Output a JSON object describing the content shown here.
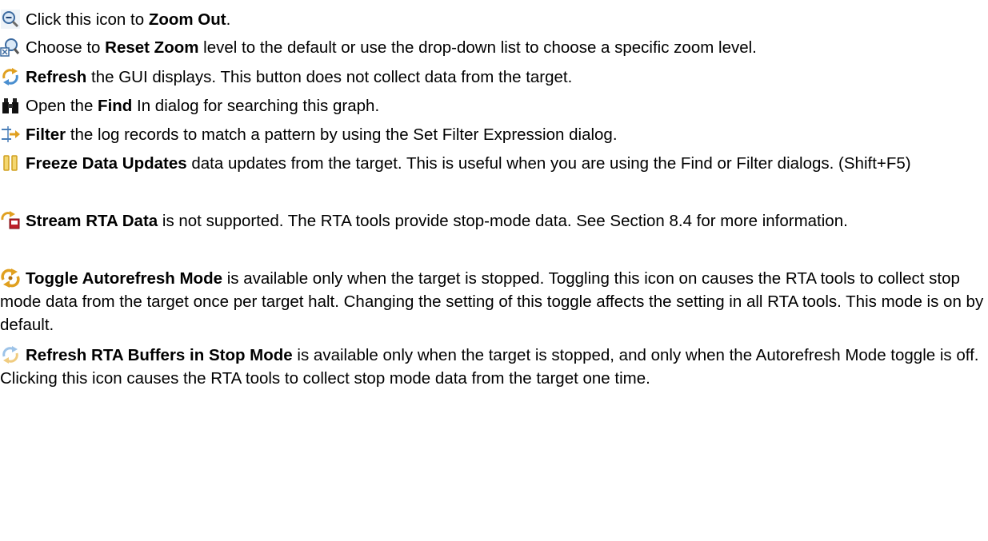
{
  "entries": [
    {
      "id": "zoom-out",
      "icon": "zoom-out-icon",
      "pre": "Click this icon to ",
      "bold": "Zoom Out",
      "post": "."
    },
    {
      "id": "reset-zoom",
      "icon": "reset-zoom-icon",
      "pre": "Choose to ",
      "bold": "Reset Zoom",
      "post": " level to the default or use the drop-down list to choose a specific zoom level."
    },
    {
      "id": "refresh",
      "icon": "refresh-icon",
      "pre": "",
      "bold": "Refresh",
      "post": " the GUI displays. This button does not collect data from the target."
    },
    {
      "id": "find",
      "icon": "binoculars-icon",
      "pre": "Open the ",
      "bold": "Find",
      "post": " In dialog for searching this graph."
    },
    {
      "id": "filter",
      "icon": "filter-icon",
      "pre": "",
      "bold": "Filter",
      "post": " the log records to match a pattern by using the Set Filter Expression dialog."
    },
    {
      "id": "freeze",
      "icon": "pause-icon",
      "pre": "",
      "bold": "Freeze Data Updates",
      "post": " data updates from the target. This is useful when you are using the Find or Filter dialogs. (Shift+F5)"
    },
    {
      "id": "stream",
      "icon": "stream-icon",
      "pre": "",
      "bold": "Stream RTA Data",
      "post": " is not supported. The RTA tools provide stop-mode data. See Section 8.4 for more information."
    },
    {
      "id": "autorefresh",
      "icon": "autorefresh-icon",
      "pre": "",
      "bold": "Toggle Autorefresh Mode",
      "post": " is available only when the target is stopped. Toggling this icon on causes the RTA tools to collect stop mode data from the target once per target halt. Changing the setting of this toggle affects the setting in all RTA tools. This mode is on by default."
    },
    {
      "id": "refresh-rta",
      "icon": "refresh-rta-icon",
      "pre": "",
      "bold": "Refresh RTA Buffers in Stop Mode",
      "post": " is available only when the target is stopped, and only when the Autorefresh Mode toggle is off. Clicking this icon causes the RTA tools to collect stop mode data from the target one time."
    }
  ]
}
